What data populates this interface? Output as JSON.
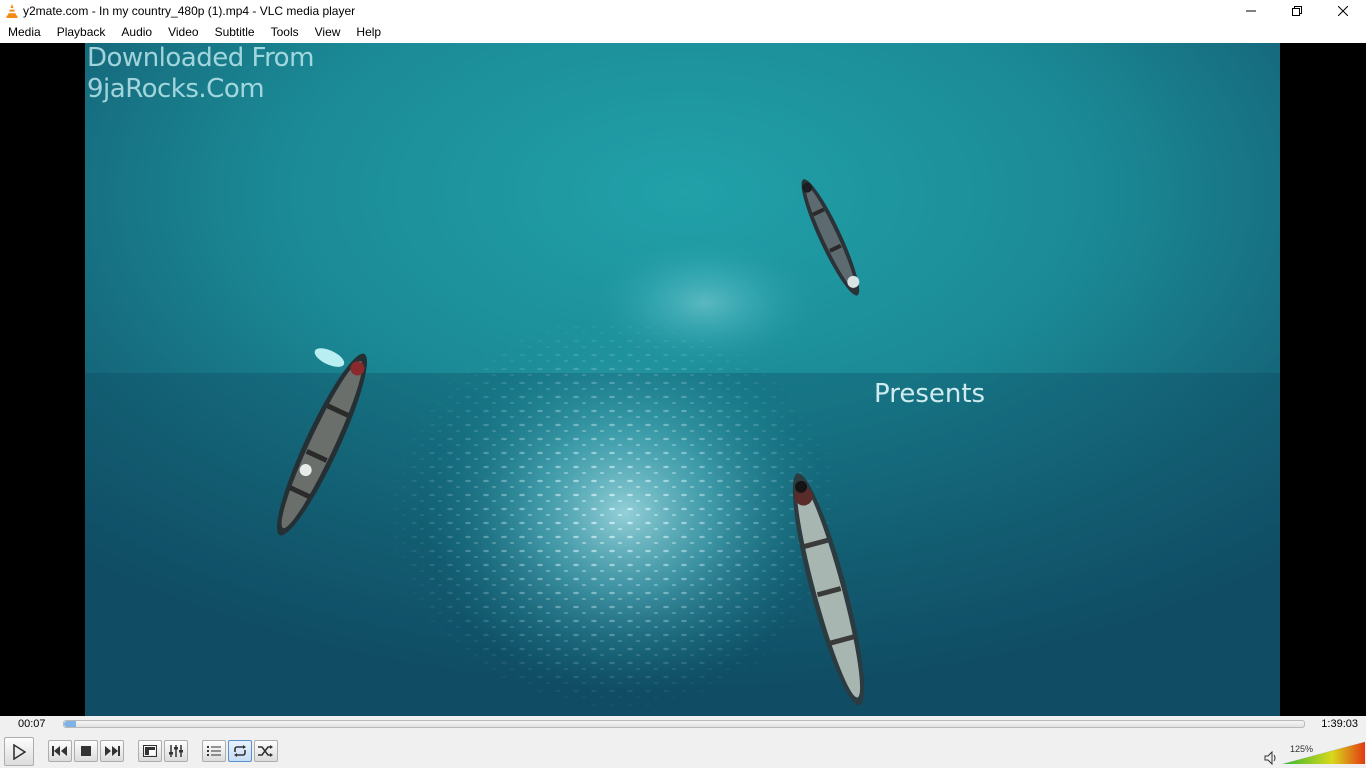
{
  "window": {
    "title": "y2mate.com - In my country_480p (1).mp4 - VLC media player",
    "app_icon": "vlc-cone-icon",
    "buttons": [
      "minimize-icon",
      "restore-icon",
      "close-icon"
    ]
  },
  "menu": {
    "items": [
      {
        "label": "Media"
      },
      {
        "label": "Playback"
      },
      {
        "label": "Audio"
      },
      {
        "label": "Video"
      },
      {
        "label": "Subtitle"
      },
      {
        "label": "Tools"
      },
      {
        "label": "View"
      },
      {
        "label": "Help"
      }
    ]
  },
  "video": {
    "watermark_line1": "Downloaded From",
    "watermark_line2": "9jaRocks.Com",
    "overlay_text": "Presents"
  },
  "seek": {
    "elapsed": "00:07",
    "total": "1:39:03",
    "progress_fraction": 0.0012
  },
  "controls": {
    "icons": [
      "play-icon",
      "previous-icon",
      "stop-icon",
      "next-icon",
      "fullscreen-icon",
      "extended-settings-icon",
      "playlist-icon",
      "loop-icon",
      "shuffle-icon"
    ],
    "loop_active": true,
    "volume_percent": "125%",
    "volume_level": 1.25,
    "colors": {
      "vol_low": "#35b832",
      "vol_mid": "#d8d81c",
      "vol_high": "#e33a12"
    }
  }
}
